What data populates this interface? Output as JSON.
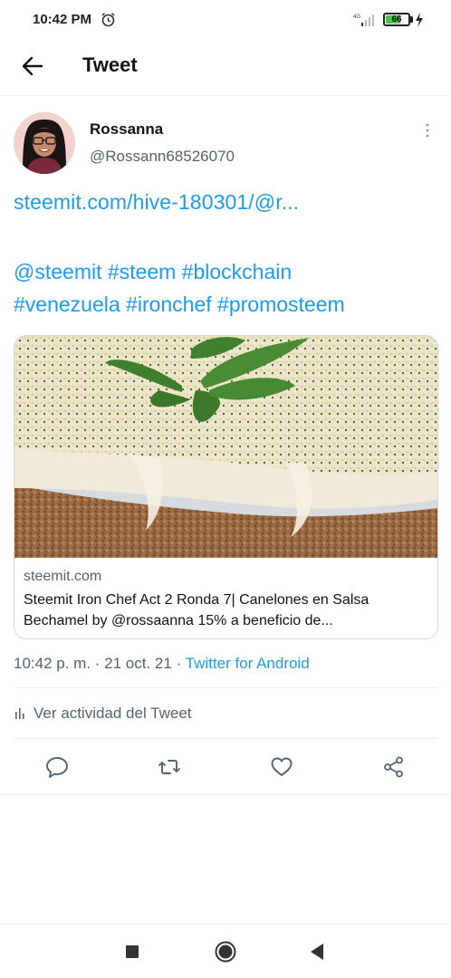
{
  "status": {
    "time": "10:42 PM",
    "network": "4G",
    "battery": "66",
    "battery_level": 0.66
  },
  "header": {
    "title": "Tweet"
  },
  "author": {
    "name": "Rossanna",
    "handle": "@Rossann68526070"
  },
  "tweet": {
    "link": "steemit.com/hive-180301/@r...",
    "tags_line1": "@steemit #steem #blockchain",
    "tags_line2": "#venezuela #ironchef #promosteem"
  },
  "card": {
    "domain": "steemit.com",
    "title": "Steemit Iron Chef Act 2 Ronda 7| Canelones en Salsa Bechamel by @rossaanna 15% a beneficio de..."
  },
  "meta": {
    "time": "10:42 p. m.",
    "sep1": " · ",
    "date": "21 oct. 21",
    "sep2": " · ",
    "source": "Twitter for Android"
  },
  "activity": {
    "label": "Ver actividad del Tweet"
  },
  "actions": [
    "reply-icon",
    "retweet-icon",
    "like-icon",
    "share-icon"
  ],
  "colors": {
    "accent": "#1d9bf0",
    "secondary_text": "#536471",
    "primary_text": "#0f1419"
  }
}
